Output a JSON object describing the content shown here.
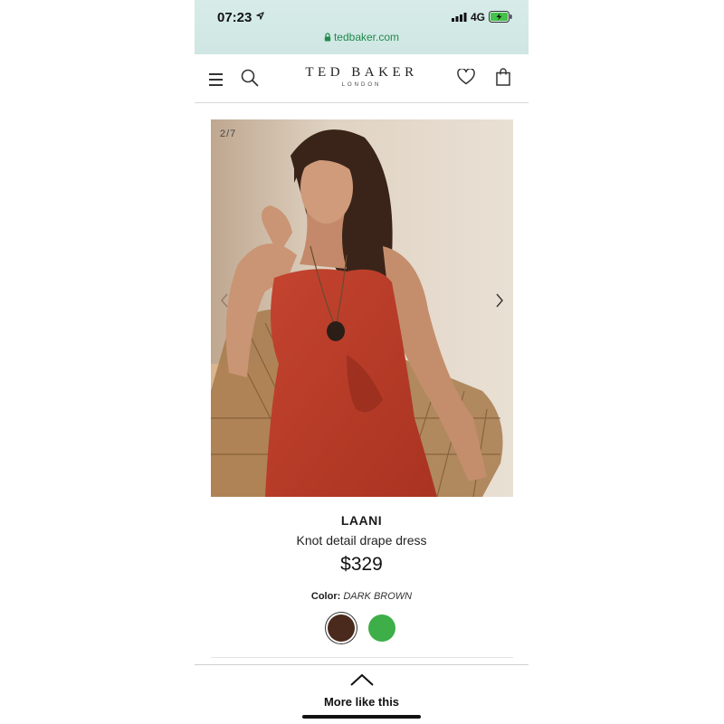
{
  "status_bar": {
    "time": "07:23",
    "network": "4G"
  },
  "url_bar": {
    "domain": "tedbaker.com"
  },
  "header": {
    "brand_name": "TED BAKER",
    "brand_sub": "LONDON"
  },
  "gallery": {
    "counter": "2/7",
    "image_description": "model-in-red-drape-dress"
  },
  "product": {
    "name": "LAANI",
    "description": "Knot detail drape dress",
    "price": "$329",
    "color_label": "Color:",
    "color_value": "DARK BROWN",
    "swatches": [
      {
        "name": "dark-brown",
        "hex": "#4a2a1c",
        "selected": true
      },
      {
        "name": "green",
        "hex": "#3eae48",
        "selected": false
      }
    ]
  },
  "drawer": {
    "label": "More like this"
  },
  "icons": {
    "menu": "menu-icon",
    "search": "search-icon",
    "wishlist": "heart-icon",
    "bag": "bag-icon",
    "next": "chevron-right-icon",
    "prev": "chevron-left-icon",
    "expand": "chevron-up-icon"
  },
  "colors": {
    "url_green": "#1f8a4c",
    "topbar_bg": "#d7ece9"
  }
}
